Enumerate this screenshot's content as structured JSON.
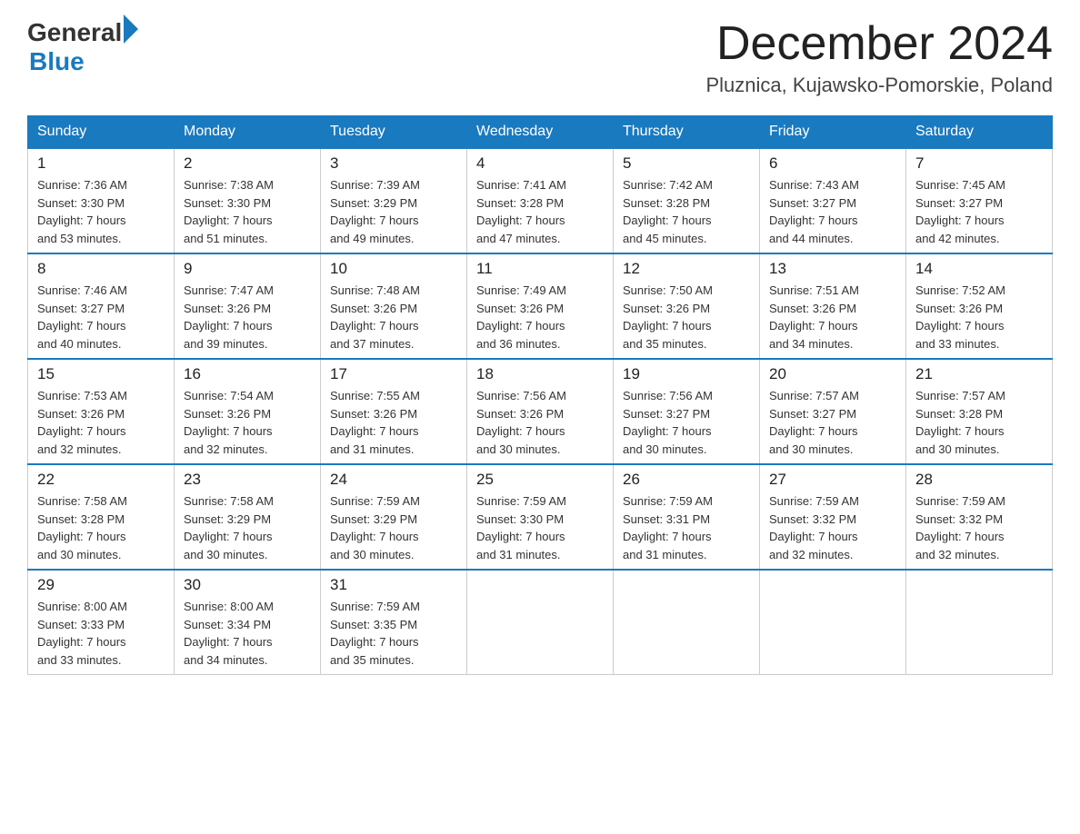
{
  "header": {
    "logo_general": "General",
    "logo_blue": "Blue",
    "month_year": "December 2024",
    "location": "Pluznica, Kujawsko-Pomorskie, Poland"
  },
  "days_of_week": [
    "Sunday",
    "Monday",
    "Tuesday",
    "Wednesday",
    "Thursday",
    "Friday",
    "Saturday"
  ],
  "weeks": [
    [
      {
        "day": "1",
        "sunrise": "Sunrise: 7:36 AM",
        "sunset": "Sunset: 3:30 PM",
        "daylight": "Daylight: 7 hours",
        "minutes": "and 53 minutes."
      },
      {
        "day": "2",
        "sunrise": "Sunrise: 7:38 AM",
        "sunset": "Sunset: 3:30 PM",
        "daylight": "Daylight: 7 hours",
        "minutes": "and 51 minutes."
      },
      {
        "day": "3",
        "sunrise": "Sunrise: 7:39 AM",
        "sunset": "Sunset: 3:29 PM",
        "daylight": "Daylight: 7 hours",
        "minutes": "and 49 minutes."
      },
      {
        "day": "4",
        "sunrise": "Sunrise: 7:41 AM",
        "sunset": "Sunset: 3:28 PM",
        "daylight": "Daylight: 7 hours",
        "minutes": "and 47 minutes."
      },
      {
        "day": "5",
        "sunrise": "Sunrise: 7:42 AM",
        "sunset": "Sunset: 3:28 PM",
        "daylight": "Daylight: 7 hours",
        "minutes": "and 45 minutes."
      },
      {
        "day": "6",
        "sunrise": "Sunrise: 7:43 AM",
        "sunset": "Sunset: 3:27 PM",
        "daylight": "Daylight: 7 hours",
        "minutes": "and 44 minutes."
      },
      {
        "day": "7",
        "sunrise": "Sunrise: 7:45 AM",
        "sunset": "Sunset: 3:27 PM",
        "daylight": "Daylight: 7 hours",
        "minutes": "and 42 minutes."
      }
    ],
    [
      {
        "day": "8",
        "sunrise": "Sunrise: 7:46 AM",
        "sunset": "Sunset: 3:27 PM",
        "daylight": "Daylight: 7 hours",
        "minutes": "and 40 minutes."
      },
      {
        "day": "9",
        "sunrise": "Sunrise: 7:47 AM",
        "sunset": "Sunset: 3:26 PM",
        "daylight": "Daylight: 7 hours",
        "minutes": "and 39 minutes."
      },
      {
        "day": "10",
        "sunrise": "Sunrise: 7:48 AM",
        "sunset": "Sunset: 3:26 PM",
        "daylight": "Daylight: 7 hours",
        "minutes": "and 37 minutes."
      },
      {
        "day": "11",
        "sunrise": "Sunrise: 7:49 AM",
        "sunset": "Sunset: 3:26 PM",
        "daylight": "Daylight: 7 hours",
        "minutes": "and 36 minutes."
      },
      {
        "day": "12",
        "sunrise": "Sunrise: 7:50 AM",
        "sunset": "Sunset: 3:26 PM",
        "daylight": "Daylight: 7 hours",
        "minutes": "and 35 minutes."
      },
      {
        "day": "13",
        "sunrise": "Sunrise: 7:51 AM",
        "sunset": "Sunset: 3:26 PM",
        "daylight": "Daylight: 7 hours",
        "minutes": "and 34 minutes."
      },
      {
        "day": "14",
        "sunrise": "Sunrise: 7:52 AM",
        "sunset": "Sunset: 3:26 PM",
        "daylight": "Daylight: 7 hours",
        "minutes": "and 33 minutes."
      }
    ],
    [
      {
        "day": "15",
        "sunrise": "Sunrise: 7:53 AM",
        "sunset": "Sunset: 3:26 PM",
        "daylight": "Daylight: 7 hours",
        "minutes": "and 32 minutes."
      },
      {
        "day": "16",
        "sunrise": "Sunrise: 7:54 AM",
        "sunset": "Sunset: 3:26 PM",
        "daylight": "Daylight: 7 hours",
        "minutes": "and 32 minutes."
      },
      {
        "day": "17",
        "sunrise": "Sunrise: 7:55 AM",
        "sunset": "Sunset: 3:26 PM",
        "daylight": "Daylight: 7 hours",
        "minutes": "and 31 minutes."
      },
      {
        "day": "18",
        "sunrise": "Sunrise: 7:56 AM",
        "sunset": "Sunset: 3:26 PM",
        "daylight": "Daylight: 7 hours",
        "minutes": "and 30 minutes."
      },
      {
        "day": "19",
        "sunrise": "Sunrise: 7:56 AM",
        "sunset": "Sunset: 3:27 PM",
        "daylight": "Daylight: 7 hours",
        "minutes": "and 30 minutes."
      },
      {
        "day": "20",
        "sunrise": "Sunrise: 7:57 AM",
        "sunset": "Sunset: 3:27 PM",
        "daylight": "Daylight: 7 hours",
        "minutes": "and 30 minutes."
      },
      {
        "day": "21",
        "sunrise": "Sunrise: 7:57 AM",
        "sunset": "Sunset: 3:28 PM",
        "daylight": "Daylight: 7 hours",
        "minutes": "and 30 minutes."
      }
    ],
    [
      {
        "day": "22",
        "sunrise": "Sunrise: 7:58 AM",
        "sunset": "Sunset: 3:28 PM",
        "daylight": "Daylight: 7 hours",
        "minutes": "and 30 minutes."
      },
      {
        "day": "23",
        "sunrise": "Sunrise: 7:58 AM",
        "sunset": "Sunset: 3:29 PM",
        "daylight": "Daylight: 7 hours",
        "minutes": "and 30 minutes."
      },
      {
        "day": "24",
        "sunrise": "Sunrise: 7:59 AM",
        "sunset": "Sunset: 3:29 PM",
        "daylight": "Daylight: 7 hours",
        "minutes": "and 30 minutes."
      },
      {
        "day": "25",
        "sunrise": "Sunrise: 7:59 AM",
        "sunset": "Sunset: 3:30 PM",
        "daylight": "Daylight: 7 hours",
        "minutes": "and 31 minutes."
      },
      {
        "day": "26",
        "sunrise": "Sunrise: 7:59 AM",
        "sunset": "Sunset: 3:31 PM",
        "daylight": "Daylight: 7 hours",
        "minutes": "and 31 minutes."
      },
      {
        "day": "27",
        "sunrise": "Sunrise: 7:59 AM",
        "sunset": "Sunset: 3:32 PM",
        "daylight": "Daylight: 7 hours",
        "minutes": "and 32 minutes."
      },
      {
        "day": "28",
        "sunrise": "Sunrise: 7:59 AM",
        "sunset": "Sunset: 3:32 PM",
        "daylight": "Daylight: 7 hours",
        "minutes": "and 32 minutes."
      }
    ],
    [
      {
        "day": "29",
        "sunrise": "Sunrise: 8:00 AM",
        "sunset": "Sunset: 3:33 PM",
        "daylight": "Daylight: 7 hours",
        "minutes": "and 33 minutes."
      },
      {
        "day": "30",
        "sunrise": "Sunrise: 8:00 AM",
        "sunset": "Sunset: 3:34 PM",
        "daylight": "Daylight: 7 hours",
        "minutes": "and 34 minutes."
      },
      {
        "day": "31",
        "sunrise": "Sunrise: 7:59 AM",
        "sunset": "Sunset: 3:35 PM",
        "daylight": "Daylight: 7 hours",
        "minutes": "and 35 minutes."
      },
      null,
      null,
      null,
      null
    ]
  ]
}
